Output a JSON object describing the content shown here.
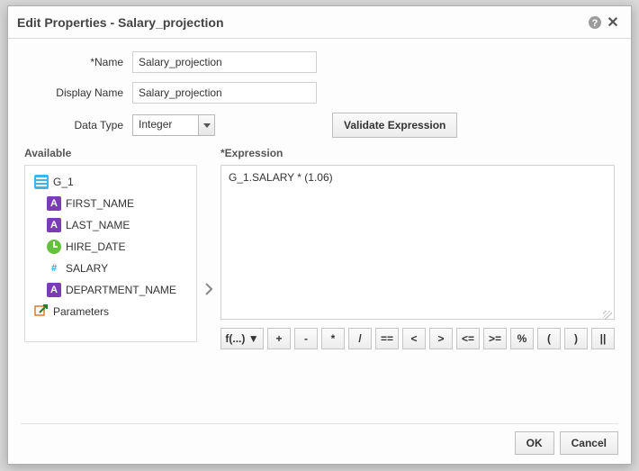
{
  "dialog": {
    "title": "Edit Properties - Salary_projection"
  },
  "form": {
    "name_label": "Name",
    "name_value": "Salary_projection",
    "display_name_label": "Display Name",
    "display_name_value": "Salary_projection",
    "data_type_label": "Data Type",
    "data_type_value": "Integer",
    "validate_label": "Validate Expression",
    "available_label": "Available",
    "expression_label": "Expression",
    "expression_value": "G_1.SALARY * (1.06)"
  },
  "tree": {
    "group": "G_1",
    "items": [
      {
        "icon": "A",
        "label": "FIRST_NAME"
      },
      {
        "icon": "A",
        "label": "LAST_NAME"
      },
      {
        "icon": "date",
        "label": "HIRE_DATE"
      },
      {
        "icon": "hash",
        "label": "SALARY"
      },
      {
        "icon": "A",
        "label": "DEPARTMENT_NAME"
      }
    ],
    "parameters_label": "Parameters"
  },
  "operators": {
    "fx": "f(...) ▼",
    "ops": [
      "+",
      "-",
      "*",
      "/",
      "==",
      "<",
      ">",
      "<=",
      ">=",
      "%",
      "(",
      ")",
      "||"
    ]
  },
  "footer": {
    "ok": "OK",
    "cancel": "Cancel"
  }
}
